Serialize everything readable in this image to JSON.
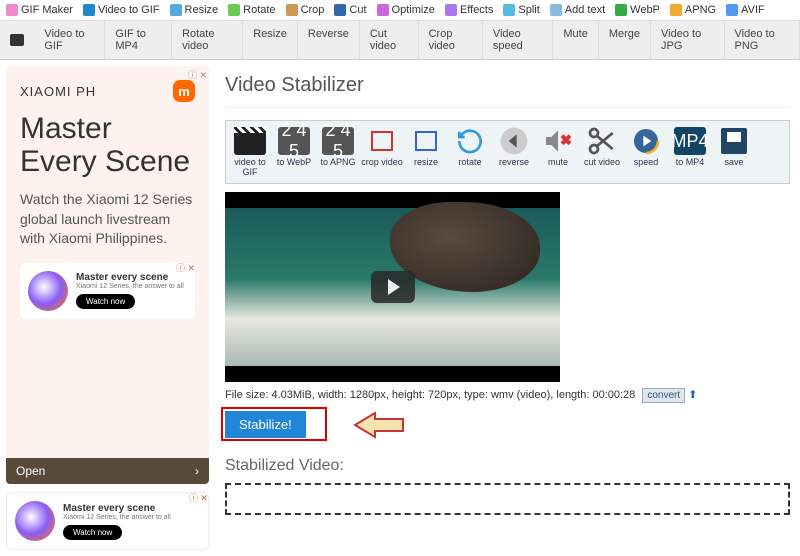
{
  "topnav": [
    {
      "label": "GIF Maker",
      "color": "#e8c"
    },
    {
      "label": "Video to GIF",
      "color": "#28c"
    },
    {
      "label": "Resize",
      "color": "#5ad"
    },
    {
      "label": "Rotate",
      "color": "#6c5"
    },
    {
      "label": "Crop",
      "color": "#c95"
    },
    {
      "label": "Cut",
      "color": "#36a"
    },
    {
      "label": "Optimize",
      "color": "#c6d"
    },
    {
      "label": "Effects",
      "color": "#a7e"
    },
    {
      "label": "Split",
      "color": "#5bd"
    },
    {
      "label": "Add text",
      "color": "#8bd"
    },
    {
      "label": "WebP",
      "color": "#3a4"
    },
    {
      "label": "APNG",
      "color": "#ea3"
    },
    {
      "label": "AVIF",
      "color": "#59e"
    }
  ],
  "subnav": [
    "Video to GIF",
    "GIF to MP4",
    "Rotate video",
    "Resize",
    "Reverse",
    "Cut video",
    "Crop video",
    "Video speed",
    "Mute",
    "Merge",
    "Video to JPG",
    "Video to PNG"
  ],
  "ad1": {
    "brand": "XIAOMI PH",
    "title": "Master Every Scene",
    "body": "Watch the Xiaomi 12 Series global launch livestream with Xiaomi Philippines.",
    "card_title": "Master every scene",
    "card_sub": "Xiaomi 12 Series, the answer to all",
    "card_btn": "Watch now",
    "open": "Open",
    "close": "ⓘ ✕"
  },
  "page_title": "Video Stabilizer",
  "toolbar": [
    {
      "label": "video to GIF",
      "t": "clap"
    },
    {
      "label": "to WebP",
      "t": "num"
    },
    {
      "label": "to APNG",
      "t": "num"
    },
    {
      "label": "crop video",
      "t": "crop"
    },
    {
      "label": "resize",
      "t": "resize"
    },
    {
      "label": "rotate",
      "t": "rotate"
    },
    {
      "label": "reverse",
      "t": "reverse"
    },
    {
      "label": "mute",
      "t": "mute"
    },
    {
      "label": "cut video",
      "t": "cut"
    },
    {
      "label": "speed",
      "t": "speed"
    },
    {
      "label": "to MP4",
      "t": "mp4"
    },
    {
      "label": "save",
      "t": "save"
    }
  ],
  "info": {
    "text": "File size: 4.03MiB, width: 1280px, height: 720px, type: wmv (video), length: 00:00:28",
    "convert": "convert"
  },
  "stabilize": "Stabilize!",
  "stabilized_label": "Stabilized Video:"
}
